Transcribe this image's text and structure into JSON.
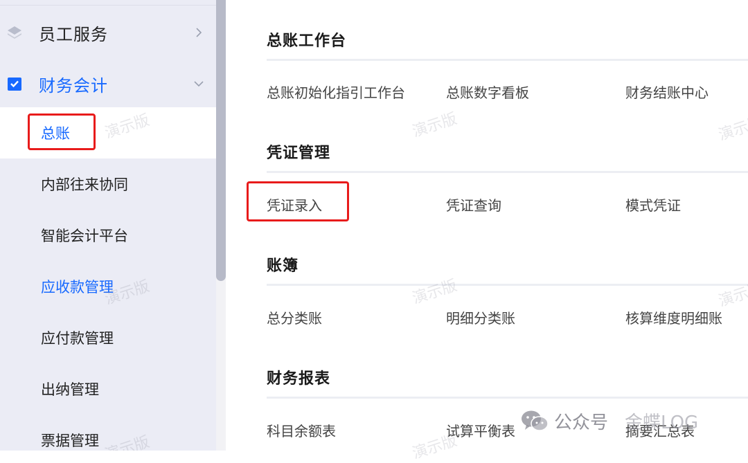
{
  "sidebar": {
    "groups": [
      {
        "label": "员工服务",
        "expanded": false
      },
      {
        "label": "财务会计",
        "expanded": true
      }
    ],
    "items": [
      {
        "label": "总账",
        "active": true
      },
      {
        "label": "内部往来协同"
      },
      {
        "label": "智能会计平台"
      },
      {
        "label": "应收款管理",
        "highlight": true
      },
      {
        "label": "应付款管理"
      },
      {
        "label": "出纳管理"
      },
      {
        "label": "票据管理"
      }
    ]
  },
  "sections": [
    {
      "title": "总账工作台",
      "items": [
        "总账初始化指引工作台",
        "总账数字看板",
        "财务结账中心"
      ]
    },
    {
      "title": "凭证管理",
      "items": [
        "凭证录入",
        "凭证查询",
        "模式凭证"
      ]
    },
    {
      "title": "账簿",
      "items": [
        "总分类账",
        "明细分类账",
        "核算维度明细账"
      ]
    },
    {
      "title": "财务报表",
      "items": [
        "科目余额表",
        "试算平衡表",
        "摘要汇总表"
      ]
    }
  ],
  "watermark": "演示版",
  "credit": {
    "label": "公众号",
    "name": "金蝶LOG",
    "icon": "wechat-icon"
  },
  "colors": {
    "accent": "#1769ff",
    "highlight_box": "#e81b1b",
    "sidebar_bg": "#ebecf5"
  }
}
